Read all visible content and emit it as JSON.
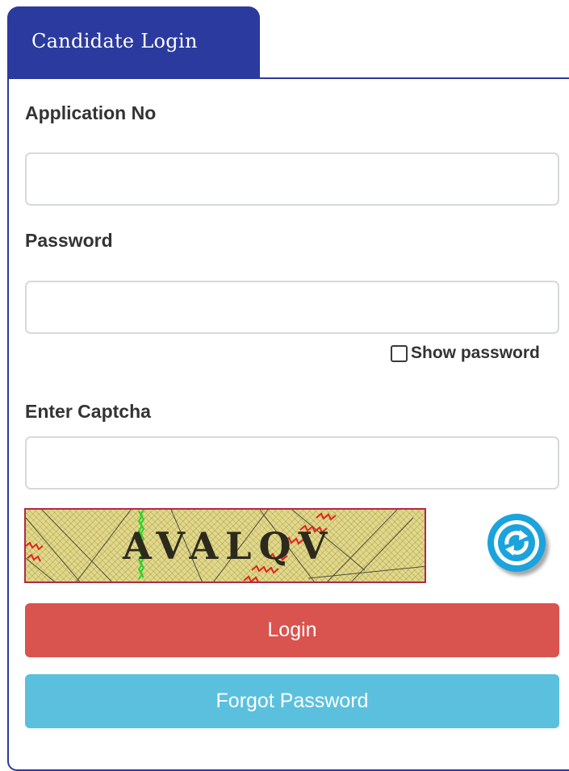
{
  "tab": {
    "title": "Candidate Login"
  },
  "form": {
    "application_no": {
      "label": "Application No",
      "value": "",
      "placeholder": ""
    },
    "password": {
      "label": "Password",
      "value": "",
      "placeholder": ""
    },
    "show_password": {
      "label": "Show password",
      "checked": false
    },
    "captcha_input": {
      "label": "Enter Captcha",
      "value": "",
      "placeholder": ""
    },
    "captcha": {
      "text": "AVALQV"
    }
  },
  "buttons": {
    "login": "Login",
    "forgot_password": "Forgot Password"
  },
  "icons": {
    "refresh": "refresh-icon"
  },
  "colors": {
    "tab_bg": "#2b3a9e",
    "login_button": "#d9534f",
    "forgot_button": "#5bc0de",
    "refresh_icon": "#1aa3dd"
  }
}
